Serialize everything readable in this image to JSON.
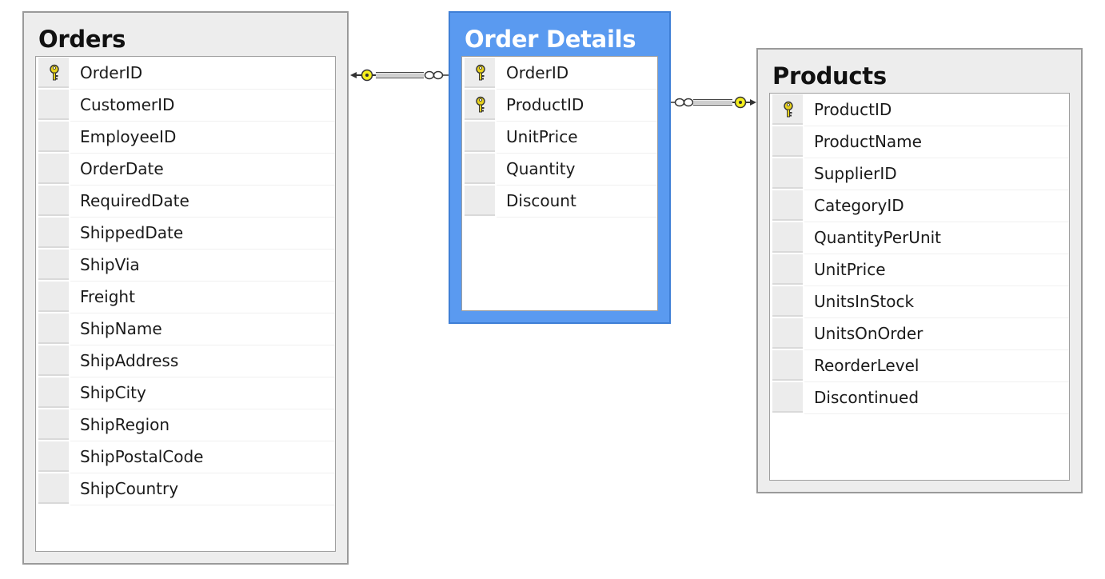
{
  "diagram": {
    "tables": [
      {
        "name": "Orders",
        "selected": false,
        "columns": [
          {
            "name": "OrderID",
            "primary_key": true
          },
          {
            "name": "CustomerID",
            "primary_key": false
          },
          {
            "name": "EmployeeID",
            "primary_key": false
          },
          {
            "name": "OrderDate",
            "primary_key": false
          },
          {
            "name": "RequiredDate",
            "primary_key": false
          },
          {
            "name": "ShippedDate",
            "primary_key": false
          },
          {
            "name": "ShipVia",
            "primary_key": false
          },
          {
            "name": "Freight",
            "primary_key": false
          },
          {
            "name": "ShipName",
            "primary_key": false
          },
          {
            "name": "ShipAddress",
            "primary_key": false
          },
          {
            "name": "ShipCity",
            "primary_key": false
          },
          {
            "name": "ShipRegion",
            "primary_key": false
          },
          {
            "name": "ShipPostalCode",
            "primary_key": false
          },
          {
            "name": "ShipCountry",
            "primary_key": false
          }
        ]
      },
      {
        "name": "Order Details",
        "selected": true,
        "columns": [
          {
            "name": "OrderID",
            "primary_key": true
          },
          {
            "name": "ProductID",
            "primary_key": true
          },
          {
            "name": "UnitPrice",
            "primary_key": false
          },
          {
            "name": "Quantity",
            "primary_key": false
          },
          {
            "name": "Discount",
            "primary_key": false
          }
        ]
      },
      {
        "name": "Products",
        "selected": false,
        "columns": [
          {
            "name": "ProductID",
            "primary_key": true
          },
          {
            "name": "ProductName",
            "primary_key": false
          },
          {
            "name": "SupplierID",
            "primary_key": false
          },
          {
            "name": "CategoryID",
            "primary_key": false
          },
          {
            "name": "QuantityPerUnit",
            "primary_key": false
          },
          {
            "name": "UnitPrice",
            "primary_key": false
          },
          {
            "name": "UnitsInStock",
            "primary_key": false
          },
          {
            "name": "UnitsOnOrder",
            "primary_key": false
          },
          {
            "name": "ReorderLevel",
            "primary_key": false
          },
          {
            "name": "Discontinued",
            "primary_key": false
          }
        ]
      }
    ],
    "relationships": [
      {
        "from_table": "Orders",
        "to_table": "Order Details",
        "from_end": "one-key-icon",
        "to_end": "many-infinity-icon"
      },
      {
        "from_table": "Products",
        "to_table": "Order Details",
        "from_end": "one-key-icon",
        "to_end": "many-infinity-icon"
      }
    ],
    "colors": {
      "selected_table": "#5a9af0",
      "table_frame": "#ededed",
      "key_icon": "#e8d21c",
      "relationship_key_icon": "#f5ef1d"
    }
  }
}
